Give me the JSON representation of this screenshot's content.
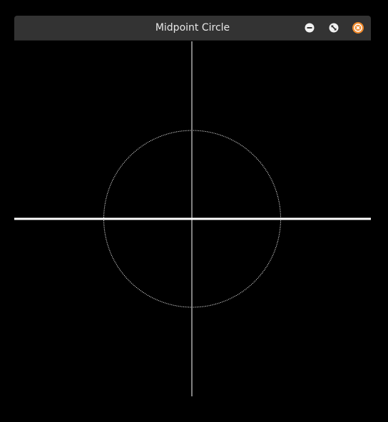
{
  "window": {
    "title": "Midpoint Circle",
    "buttons": [
      {
        "name": "minimize",
        "icon": "minus-circle-icon"
      },
      {
        "name": "maximize",
        "icon": "diagonal-arrows-circle-icon"
      },
      {
        "name": "close",
        "icon": "close-circle-icon",
        "accent": "#f08a2c"
      }
    ]
  },
  "colors": {
    "background": "#000000",
    "titlebar": "#333333",
    "drawing": "#ffffff",
    "close_accent": "#f08a2c",
    "button_fill": "#f2f2f2"
  }
}
